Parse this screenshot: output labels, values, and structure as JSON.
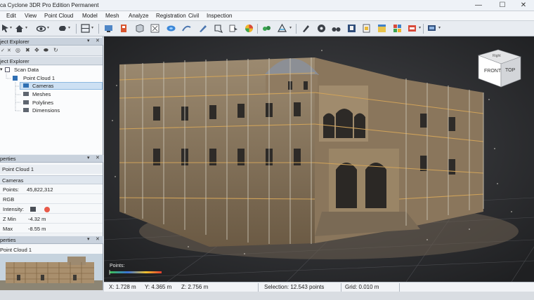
{
  "window": {
    "title": "ca Cyclone 3DR Pro Edition Permanent",
    "controls": {
      "minimize": "—",
      "maximize": "☐",
      "close": "✕"
    }
  },
  "menu": {
    "items": [
      "Edit",
      "View",
      "Point Cloud",
      "Model",
      "Mesh",
      "Analyze",
      "Registration",
      "Civil",
      "Inspection"
    ]
  },
  "toolbar": {
    "icons": [
      "select-icon",
      "home-icon",
      "orbit-icon",
      "pan-icon",
      "layout-icon",
      "camera-view-icon",
      "scan-icon",
      "cube-view-icon",
      "grid-icon",
      "sphere-icon",
      "measure-icon",
      "brush-icon",
      "clip-icon",
      "section-icon",
      "color-icon",
      "point-cloud-icon",
      "filter-icon",
      "pen-icon",
      "settings-icon",
      "binoculars-icon",
      "image-icon",
      "layers-icon",
      "table-icon",
      "palette-icon",
      "export-icon",
      "display-icon"
    ]
  },
  "explorer": {
    "header": "ject Explorer",
    "tree_header": "ject Explorer",
    "items": [
      {
        "label": "Scan Data",
        "level": 0
      },
      {
        "label": "Point Cloud 1",
        "level": 1
      },
      {
        "label": "Cameras",
        "level": 2
      },
      {
        "label": "Meshes",
        "level": 2
      },
      {
        "label": "Polylines",
        "level": 2
      },
      {
        "label": "Dimensions",
        "level": 2
      }
    ]
  },
  "properties": {
    "header": "perties",
    "object": "Point Cloud 1",
    "group": "Cameras",
    "rows": [
      {
        "label": "Points:",
        "value": "45,822,312"
      },
      {
        "label": "RGB",
        "value": ""
      },
      {
        "label": "Intensity:",
        "value": ""
      },
      {
        "label": "Z Min",
        "value": "-4.32 m"
      },
      {
        "label": "Max",
        "value": "-8.55 m"
      }
    ]
  },
  "preview": {
    "header": "perties",
    "title": "Point Cloud 1"
  },
  "viewport": {
    "cube": {
      "front": "FRONT",
      "top": "TOP",
      "right": "Right"
    },
    "legend_label": "Points:"
  },
  "status": {
    "x": "X: 1.728 m",
    "y": "Y: 4.365 m",
    "z": "Z: 2.756 m",
    "selection": "Selection: 12.543 points",
    "grid": "Grid: 0.010 m"
  },
  "colors": {
    "accent": "#2f6fb3",
    "viewport_bg": "#2a2b2e",
    "legend_gradient": [
      "#e23b2e",
      "#f0c12c",
      "#3cc252",
      "#3a73d9"
    ]
  }
}
